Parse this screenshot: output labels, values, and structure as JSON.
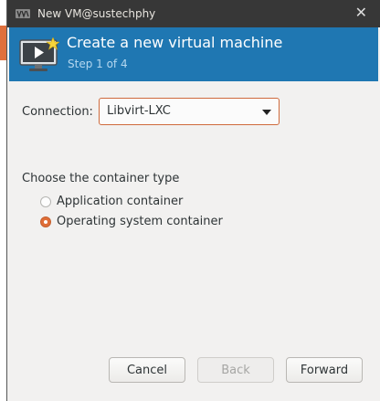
{
  "window": {
    "title": "New VM@sustechphy"
  },
  "banner": {
    "heading": "Create a new virtual machine",
    "step": "Step 1 of 4"
  },
  "connection": {
    "label": "Connection:",
    "value": "Libvirt-LXC"
  },
  "container_type": {
    "heading": "Choose the container type",
    "options": [
      {
        "label": "Application container",
        "selected": false
      },
      {
        "label": "Operating system container",
        "selected": true
      }
    ]
  },
  "buttons": {
    "cancel": "Cancel",
    "back": "Back",
    "forward": "Forward"
  },
  "colors": {
    "banner": "#1f77b2",
    "accent": "#df6d37",
    "titlebar": "#373737"
  }
}
